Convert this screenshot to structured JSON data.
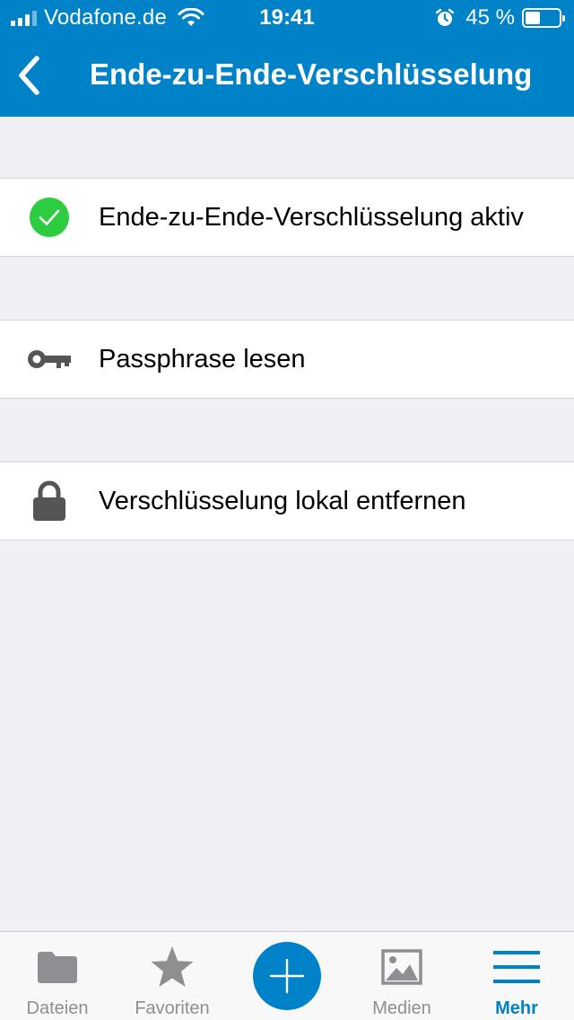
{
  "status_bar": {
    "carrier": "Vodafone.de",
    "time": "19:41",
    "battery_percent": "45 %",
    "battery_level": 0.45
  },
  "nav": {
    "title": "Ende-zu-Ende-Verschlüsselung"
  },
  "rows": [
    {
      "label": "Ende-zu-Ende-Verschlüsselung aktiv",
      "icon": "check-circle-icon",
      "icon_color": "#2ecc40"
    },
    {
      "label": "Passphrase lesen",
      "icon": "key-icon",
      "icon_color": "#555555"
    },
    {
      "label": "Verschlüsselung lokal entfernen",
      "icon": "lock-icon",
      "icon_color": "#555555"
    }
  ],
  "tabs": [
    {
      "label": "Dateien",
      "icon": "folder-icon",
      "active": false
    },
    {
      "label": "Favoriten",
      "icon": "star-icon",
      "active": false
    },
    {
      "label": "Medien",
      "icon": "image-icon",
      "active": false
    },
    {
      "label": "Mehr",
      "icon": "menu-icon",
      "active": true
    }
  ],
  "colors": {
    "accent": "#0082c9",
    "inactive": "#8e8e93",
    "background": "#efeff4"
  }
}
